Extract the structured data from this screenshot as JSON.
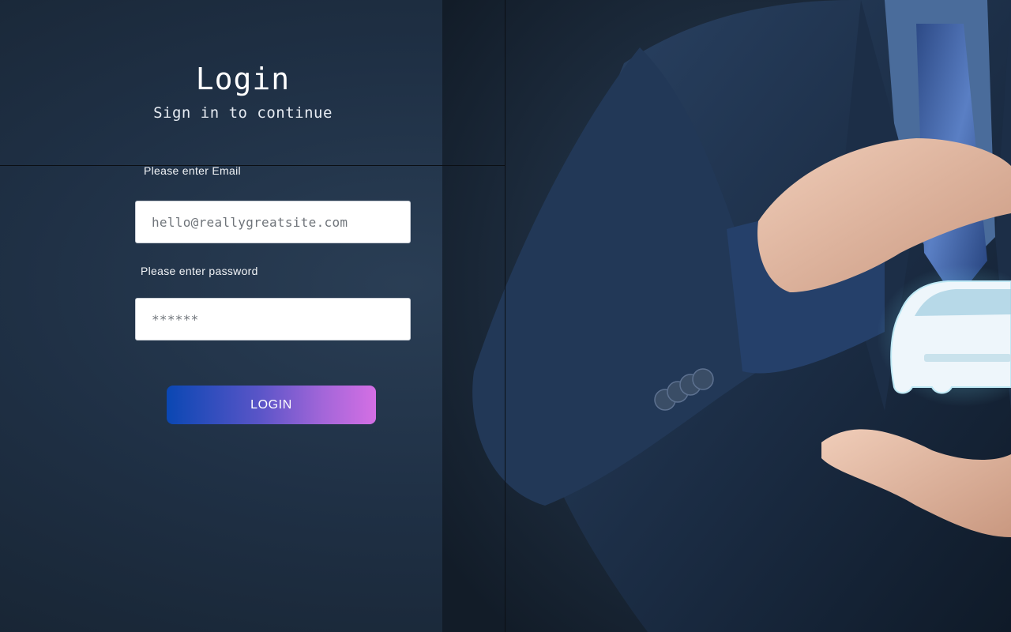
{
  "login": {
    "title": "Login",
    "subtitle": "Sign in to continue",
    "email_label": "Please enter Email",
    "email_placeholder": "hello@reallygreatsite.com",
    "password_label": "Please enter password",
    "password_placeholder": "******",
    "button_label": "LOGIN"
  },
  "colors": {
    "background": "#1f3045",
    "button_gradient_start": "#0a47b3",
    "button_gradient_end": "#d46fe4"
  },
  "hero_image": {
    "subject": "businessman-protecting-car-icon"
  }
}
